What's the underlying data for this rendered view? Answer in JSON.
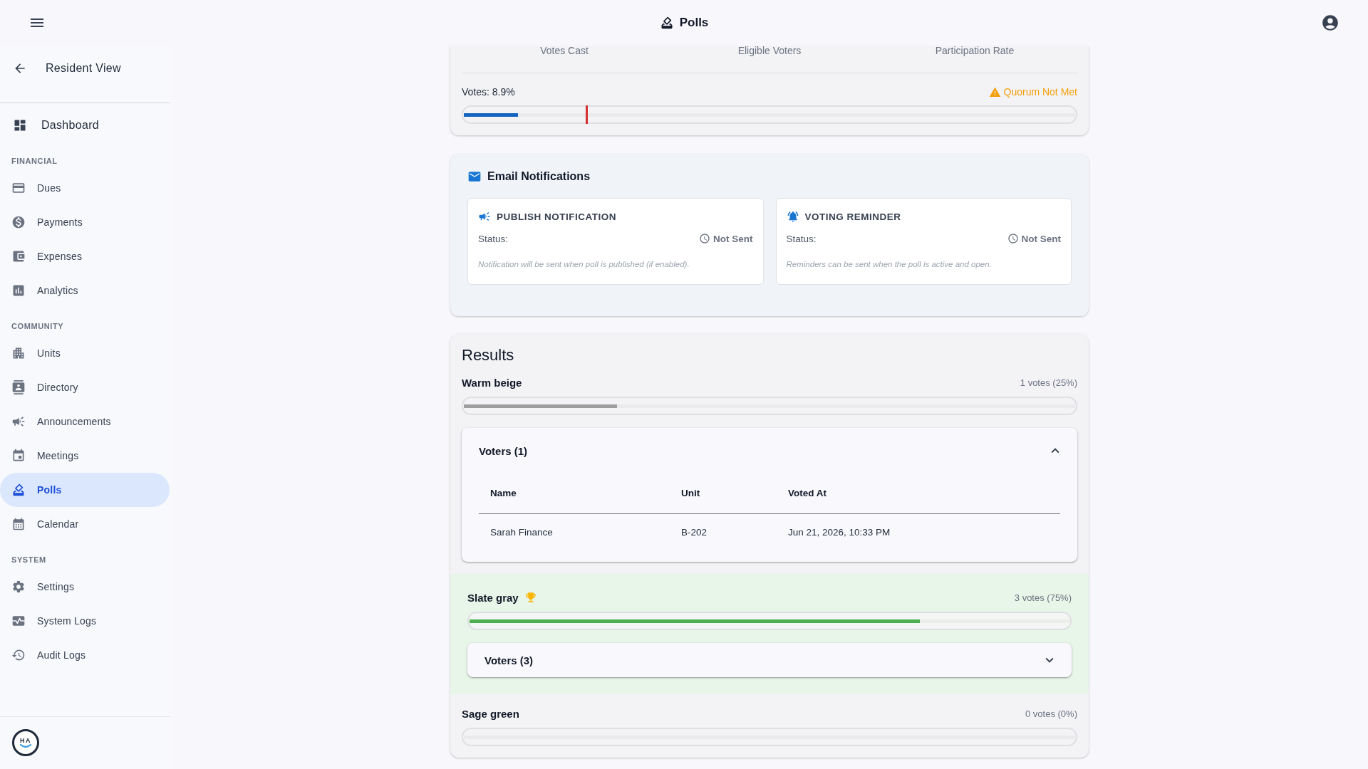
{
  "app_bar": {
    "title": "Polls"
  },
  "sidebar": {
    "back_link": {
      "label": "Resident View"
    },
    "dashboard": {
      "label": "Dashboard",
      "selected": false
    },
    "sections": [
      {
        "heading": "FINANCIAL",
        "items": [
          {
            "label": "Dues",
            "selected": false
          },
          {
            "label": "Payments",
            "selected": false
          },
          {
            "label": "Expenses",
            "selected": false
          },
          {
            "label": "Analytics",
            "selected": false
          }
        ]
      },
      {
        "heading": "COMMUNITY",
        "items": [
          {
            "label": "Units",
            "selected": false
          },
          {
            "label": "Directory",
            "selected": false
          },
          {
            "label": "Announcements",
            "selected": false
          },
          {
            "label": "Meetings",
            "selected": false
          },
          {
            "label": "Polls",
            "selected": true
          },
          {
            "label": "Calendar",
            "selected": false
          }
        ]
      },
      {
        "heading": "SYSTEM",
        "items": [
          {
            "label": "Settings",
            "selected": false
          },
          {
            "label": "System Logs",
            "selected": false
          },
          {
            "label": "Audit Logs",
            "selected": false
          }
        ]
      }
    ],
    "logo": {
      "text": "HA"
    }
  },
  "participation": {
    "stats": [
      {
        "label": "Votes Cast"
      },
      {
        "label": "Eligible Voters"
      },
      {
        "label": "Participation Rate"
      }
    ],
    "votes_label": "Votes: 8.9%",
    "quorum": {
      "label": "Quorum Not Met",
      "met": false
    },
    "progress": {
      "level": 0.089
    },
    "quorum_marker": {
      "level": 0.2
    }
  },
  "email_notifications": {
    "title": "Email Notifications",
    "cards": [
      {
        "title": "PUBLISH NOTIFICATION",
        "status_label": "Status:",
        "status": "Not Sent",
        "note": "Notification will be sent when poll is published (if enabled)."
      },
      {
        "title": "VOTING REMINDER",
        "status_label": "Status:",
        "status": "Not Sent",
        "note": "Reminders can be sent when the poll is active and open."
      }
    ]
  },
  "results": {
    "title": "Results",
    "options": [
      {
        "name": "Warm beige",
        "count": "1 votes (25%)",
        "level": 0.25,
        "winner": false,
        "voters": {
          "label": "Voters (1)",
          "expanded": true,
          "columns": [
            "Name",
            "Unit",
            "Voted At"
          ],
          "rows": [
            {
              "name": "Sarah Finance",
              "unit": "B-202",
              "voted_at": "Jun 21, 2026, 10:33 PM"
            }
          ]
        }
      },
      {
        "name": "Slate gray",
        "count": "3 votes (75%)",
        "level": 0.75,
        "winner": true,
        "voters": {
          "label": "Voters (3)",
          "expanded": false
        }
      },
      {
        "name": "Sage green",
        "count": "0 votes (0%)",
        "winner": false
      }
    ]
  }
}
